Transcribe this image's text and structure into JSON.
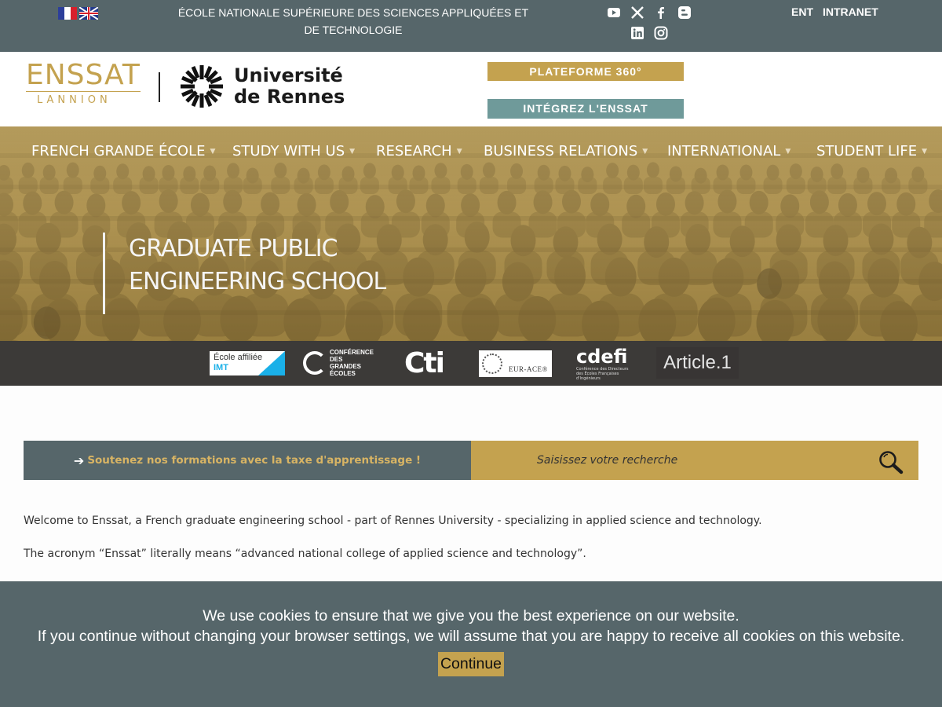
{
  "topbar": {
    "school_name": "ÉCOLE NATIONALE SUPÉRIEURE DES SCIENCES APPLIQUÉES ET DE TECHNOLOGIE",
    "links": [
      "ENT",
      "INTRANET"
    ],
    "social_icons": [
      "youtube-icon",
      "x-icon",
      "facebook-icon",
      "blogger-icon",
      "linkedin-icon",
      "instagram-icon"
    ]
  },
  "header": {
    "enssat_word": "ENSSAT",
    "enssat_city": "LANNION",
    "university_line1": "Université",
    "university_line2": "de Rennes",
    "btn_platform": "PLATEFORME 360°",
    "btn_integrez": "INTÉGREZ L'ENSSAT"
  },
  "nav": {
    "items": [
      "FRENCH GRANDE ÉCOLE",
      "STUDY WITH US",
      "RESEARCH",
      "BUSINESS RELATIONS",
      "INTERNATIONAL",
      "STUDENT LIFE"
    ]
  },
  "hero": {
    "title_line1": "GRADUATE PUBLIC",
    "title_line2": "ENGINEERING SCHOOL"
  },
  "partners": {
    "imt_line1": "École affiliée",
    "imt_line2": "IMT",
    "cge_text": "CONFÉRENCE DES GRANDES ÉCOLES",
    "cti": "Cti",
    "eur_ace": "EUR-ACE®",
    "cdefi": "cdefi",
    "cdefi_small": "Conférence des Directeurs des Écoles Françaises d'Ingénieurs",
    "article1": "Article.1"
  },
  "actions": {
    "tax_label": "Soutenez nos formations avec la taxe d'apprentissage !",
    "search_placeholder": "Saisissez votre recherche"
  },
  "content": {
    "welcome": "Welcome to Enssat, a French graduate engineering school - part of Rennes University - specializing in applied science and technology.",
    "acronym": "The acronym “Enssat” literally means “advanced national college of applied science and technology”."
  },
  "cookie": {
    "line1": "We use cookies to ensure that we give you the best experience on our website.",
    "line2": "If you continue without changing your browser settings, we will assume that you are happy to receive all cookies on this website.",
    "button": "Continue"
  },
  "colors": {
    "slate": "#56666a",
    "gold": "#c4a24f",
    "teal": "#6f9a9a",
    "partner_bar": "#3c3a38"
  }
}
